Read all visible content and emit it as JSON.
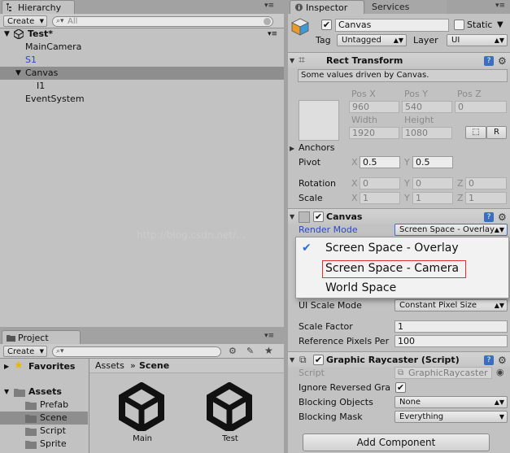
{
  "hierarchy": {
    "tab": "Hierarchy",
    "create_label": "Create",
    "search_placeholder": "All",
    "scene": "Test*",
    "items": [
      "MainCamera",
      "S1",
      "Canvas",
      "I1",
      "EventSystem"
    ]
  },
  "project": {
    "tab": "Project",
    "create_label": "Create",
    "favorites": "Favorites",
    "assets": "Assets",
    "folders": [
      "Prefab",
      "Scene",
      "Script",
      "Sprite"
    ],
    "breadcrumb_root": "Assets",
    "breadcrumb_sep": "»",
    "breadcrumb_current": "Scene",
    "files": [
      "Main",
      "Test"
    ]
  },
  "inspector": {
    "tab": "Inspector",
    "tab2": "Services",
    "object_name": "Canvas",
    "static_label": "Static",
    "tag_label": "Tag",
    "tag_value": "Untagged",
    "layer_label": "Layer",
    "layer_value": "UI",
    "rect": {
      "title": "Rect Transform",
      "note": "Some values driven by Canvas.",
      "posx_label": "Pos X",
      "posy_label": "Pos Y",
      "posz_label": "Pos Z",
      "posx": "960",
      "posy": "540",
      "posz": "0",
      "width_label": "Width",
      "height_label": "Height",
      "width": "1920",
      "height": "1080",
      "r_button": "R",
      "anchors": "Anchors",
      "pivot": "Pivot",
      "pivot_x": "0.5",
      "pivot_y": "0.5",
      "rotation": "Rotation",
      "rot_x": "0",
      "rot_y": "0",
      "rot_z": "0",
      "scale": "Scale",
      "scale_x": "1",
      "scale_y": "1",
      "scale_z": "1",
      "x": "X",
      "y": "Y",
      "z": "Z"
    },
    "canvas": {
      "title": "Canvas",
      "render_mode_label": "Render Mode",
      "render_mode_value": "Screen Space - Overlay",
      "options": [
        "Screen Space - Overlay",
        "Screen Space - Camera",
        "World Space"
      ],
      "check": "✔"
    },
    "scaler": {
      "ui_scale_label": "UI Scale Mode",
      "ui_scale_value": "Constant Pixel Size",
      "scale_factor_label": "Scale Factor",
      "scale_factor": "1",
      "ref_ppu_label": "Reference Pixels Per",
      "ref_ppu": "100"
    },
    "raycaster": {
      "title": "Graphic Raycaster (Script)",
      "script_label": "Script",
      "script_value": "GraphicRaycaster",
      "ignore_label": "Ignore Reversed Gra",
      "blocking_objects_label": "Blocking Objects",
      "blocking_objects_value": "None",
      "blocking_mask_label": "Blocking Mask",
      "blocking_mask_value": "Everything"
    },
    "add_component": "Add Component"
  },
  "watermark": "http://blog.csdn.net/...",
  "colors": {
    "panel": "#c2c2c2",
    "selection": "#8e8e8e",
    "link_blue": "#2a47c8",
    "highlight_red": "#e03030",
    "check_blue": "#2a6fd0"
  }
}
